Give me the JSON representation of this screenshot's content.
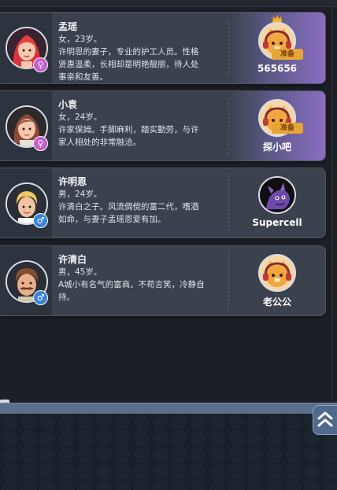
{
  "roles": [
    {
      "name": "孟瑶",
      "gender": "female",
      "gender_symbol": "♀",
      "desc_lines": [
        "女，23岁。",
        "许明恩的妻子，专业的护工人员。性格",
        "贤惠温柔，长相却是明艳靓丽，待人处",
        "事亲和友善。"
      ],
      "player": {
        "name": "565656",
        "avatar_icon": "cat-headphones-icon",
        "status": "准备",
        "owner_crown": true
      },
      "highlight": true
    },
    {
      "name": "小袁",
      "gender": "female",
      "gender_symbol": "♀",
      "desc_lines": [
        "女，24岁。",
        "许家保姆。手脚麻利，踏实勤劳，与许",
        "家人相处的非常融洽。"
      ],
      "player": {
        "name": "探小吧",
        "avatar_icon": "cat-headphones-icon",
        "status": "准备",
        "owner_crown": false
      },
      "highlight": true
    },
    {
      "name": "许明恩",
      "gender": "male",
      "gender_symbol": "♂",
      "desc_lines": [
        "男，24岁。",
        "许清白之子。风流倜傥的富二代，嗜酒",
        "如命，与妻子孟瑶恩爱有加。"
      ],
      "player": {
        "name": "Supercell",
        "avatar_icon": "purple-dragon-icon",
        "status": "",
        "owner_crown": false
      },
      "highlight": false
    },
    {
      "name": "许清白",
      "gender": "male",
      "gender_symbol": "♂",
      "desc_lines": [
        "男，45岁。",
        "A城小有名气的富商。不苟言笑，冷静自",
        "持。"
      ],
      "player": {
        "name": "老公公",
        "avatar_icon": "cat-headphones-icon",
        "status": "",
        "owner_crown": false
      },
      "highlight": false
    }
  ],
  "colors": {
    "card_bg": "#3b424d",
    "highlight_purple": "#8a6ec2",
    "ready_badge": "#e5a637",
    "female_badge": "#c65fd0",
    "male_badge": "#3b85d9"
  },
  "icons": {
    "menu_handle": "ellipsis-icon",
    "collapse": "double-chevron-up-icon"
  },
  "menu_handle_text": "···"
}
